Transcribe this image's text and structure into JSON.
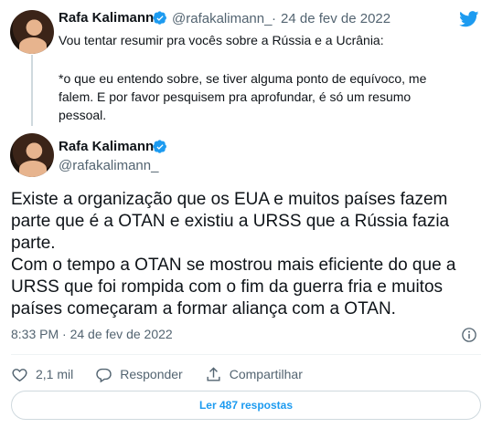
{
  "parent_tweet": {
    "author_name": "Rafa Kalimann",
    "handle": "@rafakalimann_",
    "separator": "·",
    "date": "24 de fev de 2022",
    "lines": [
      "Vou tentar resumir pra vocês sobre a Rússia e a Ucrânia:",
      "",
      "*o que eu entendo sobre, se tiver alguma ponto de equívoco, me",
      "falem. E por favor pesquisem pra aprofundar, é só um resumo",
      "pessoal."
    ]
  },
  "main_tweet": {
    "author_name": "Rafa Kalimann",
    "handle": "@rafakalimann_",
    "lines": [
      "Existe a organização que os EUA e muitos países fazem",
      "parte que é a OTAN e existiu a URSS que a Rússia fazia",
      "parte.",
      "Com o tempo a OTAN se mostrou mais eficiente do que a",
      "URSS que foi rompida com o fim da guerra fria e muitos",
      "países começaram a formar aliança com a OTAN."
    ],
    "timestamp": "8:33 PM · 24 de fev de 2022"
  },
  "actions": {
    "like_count": "2,1 mil",
    "reply_label": "Responder",
    "share_label": "Compartilhar"
  },
  "read_replies_label": "Ler 487 respostas",
  "colors": {
    "accent": "#1d9bf0",
    "secondary_text": "#536471",
    "primary_text": "#0f1419",
    "border": "#cfd9de"
  }
}
